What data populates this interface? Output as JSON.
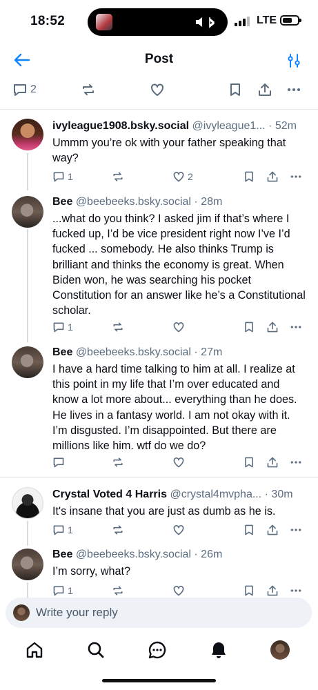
{
  "status_bar": {
    "time": "18:52",
    "network": "LTE"
  },
  "header": {
    "title": "Post"
  },
  "parent_actions": {
    "reply_count": "2"
  },
  "posts": [
    {
      "author": "ivyleague1908.bsky.social",
      "handle": "@ivyleague1...",
      "age": "· 52m",
      "text": "Ummm you’re ok with your father speaking that way?",
      "replies": "1",
      "likes": "2"
    },
    {
      "author": "Bee",
      "handle": "@beebeeks.bsky.social",
      "age": "· 28m",
      "text": "...what do you think? I asked jim if that’s where I fucked up, I’d be vice president right now I’ve I’d fucked ... somebody. He also thinks Trump is brilliant and thinks the economy is great. When Biden won, he was searching his pocket Constitution for an answer like he’s a Constitutional scholar.",
      "replies": "1",
      "likes": ""
    },
    {
      "author": "Bee",
      "handle": "@beebeeks.bsky.social",
      "age": "· 27m",
      "text": "I have a hard time talking to him at all. I realize at this point in my life that I’m over educated and know a lot more about... everything than he does. He lives in a fantasy world. I am not okay with it. I’m disgusted. I’m disappointed. But there are millions like him. wtf do we do?",
      "replies": "",
      "likes": ""
    },
    {
      "author": "Crystal Voted 4 Harris",
      "handle": "@crystal4mvpha...",
      "age": "· 30m",
      "text": "It's insane that you are just as dumb as he is.",
      "replies": "1",
      "likes": ""
    },
    {
      "author": "Bee",
      "handle": "@beebeeks.bsky.social",
      "age": "· 26m",
      "text": "I’m sorry, what?",
      "replies": "1",
      "likes": ""
    }
  ],
  "composer": {
    "placeholder": "Write your reply"
  },
  "colors": {
    "accent": "#1083fe",
    "icon": "#5b6d7f",
    "divider": "#e5e9ee"
  }
}
